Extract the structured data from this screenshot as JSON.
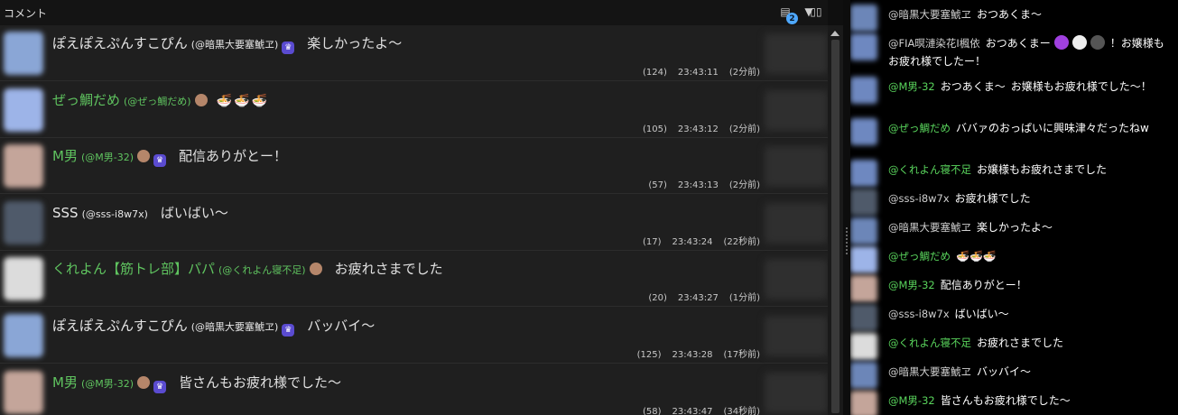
{
  "left_panel": {
    "title": "コメント",
    "header_icons": [
      {
        "name": "comment-inbox-icon",
        "glyph": "▤"
      },
      {
        "name": "filter-icon",
        "glyph": "▼"
      },
      {
        "name": "columns-icon",
        "glyph": "▯▯"
      }
    ],
    "badge_count": "2",
    "rows": [
      {
        "name": "ぽえぽえぷんすこぴん",
        "handle": "(@暗黒大要塞鯱ヱ)",
        "message": "楽しかったよ〜",
        "count": "(124)",
        "time": "23:43:11",
        "ago": "(2分前)",
        "green": false,
        "bear": false,
        "crown": true,
        "bowls": "",
        "avatar_color": "#8aa6d6"
      },
      {
        "name": "ぜっ鯛だめ",
        "handle": "(@ぜっ鯛だめ)",
        "message": "",
        "count": "(105)",
        "time": "23:43:12",
        "ago": "(2分前)",
        "green": true,
        "bear": true,
        "crown": false,
        "bowls": "🍜🍜🍜",
        "avatar_color": "#9db4e8"
      },
      {
        "name": "M男",
        "handle": "(@M男-32)",
        "message": "配信ありがとー！",
        "count": "(57)",
        "time": "23:43:13",
        "ago": "(2分前)",
        "green": true,
        "bear": true,
        "crown": true,
        "bowls": "",
        "avatar_color": "#c4a59a"
      },
      {
        "name": "SSS",
        "handle": "(@sss-i8w7x)",
        "message": "ばいばい〜",
        "count": "(17)",
        "time": "23:43:24",
        "ago": "(22秒前)",
        "green": false,
        "bear": false,
        "crown": false,
        "bowls": "",
        "avatar_color": "#4f5a6a"
      },
      {
        "name": "くれよん【筋トレ部】パパ",
        "handle": "(@くれよん寝不足)",
        "message": "お疲れさまでした",
        "count": "(20)",
        "time": "23:43:27",
        "ago": "(1分前)",
        "green": true,
        "bear": true,
        "crown": false,
        "bowls": "",
        "avatar_color": "#dcdcdc"
      },
      {
        "name": "ぽえぽえぷんすこぴん",
        "handle": "(@暗黒大要塞鯱ヱ)",
        "message": "バッバイ〜",
        "count": "(125)",
        "time": "23:43:28",
        "ago": "(17秒前)",
        "green": false,
        "bear": false,
        "crown": true,
        "bowls": "",
        "avatar_color": "#8aa6d6"
      },
      {
        "name": "M男",
        "handle": "(@M男-32)",
        "message": "皆さんもお疲れ様でした〜",
        "count": "(58)",
        "time": "23:43:47",
        "ago": "(34秒前)",
        "green": true,
        "bear": true,
        "crown": true,
        "bowls": "",
        "avatar_color": "#c4a59a"
      }
    ]
  },
  "right_panel": {
    "lines": [
      {
        "name": "@暗黒大要塞鯱ヱ",
        "text": "おつあくま〜",
        "green": false,
        "avatar_color": "#6c86b8",
        "hearts": []
      },
      {
        "name": "@FIA暝漣染花I楓依",
        "text": "おつあくまー",
        "after": "！お嬢様もお疲れ様でしたー！",
        "green": false,
        "avatar_color": "#6e88c0",
        "hearts": [
          "#a040e0",
          "#eeeeee",
          "#555555"
        ]
      },
      {
        "name": "@M男-32",
        "text": "おつあくま〜",
        "after": "お嬢様もお疲れ様でした〜！",
        "green": true,
        "avatar_color": "#6e88c0",
        "hearts": []
      },
      {
        "name": "@ぜっ鯛だめ",
        "text": "ババァのおっぱいに興味津々だったねw",
        "green": true,
        "avatar_color": "#6e88c0",
        "hearts": []
      },
      {
        "name": "@くれよん寝不足",
        "text": "お嬢様もお疲れさまでした",
        "green": true,
        "avatar_color": "#6e88c0",
        "hearts": []
      },
      {
        "name": "@sss-i8w7x",
        "text": "お疲れ様でした",
        "green": false,
        "avatar_color": "#4f5a6a",
        "hearts": []
      },
      {
        "name": "@暗黒大要塞鯱ヱ",
        "text": "楽しかったよ〜",
        "green": false,
        "avatar_color": "#6c86b8",
        "hearts": []
      },
      {
        "name": "@ぜっ鯛だめ",
        "text": "🍜🍜🍜",
        "green": true,
        "avatar_color": "#9db4e8",
        "hearts": []
      },
      {
        "name": "@M男-32",
        "text": "配信ありがとー！",
        "green": true,
        "avatar_color": "#c4a59a",
        "hearts": []
      },
      {
        "name": "@sss-i8w7x",
        "text": "ばいばい〜",
        "green": false,
        "avatar_color": "#4f5a6a",
        "hearts": []
      },
      {
        "name": "@くれよん寝不足",
        "text": "お疲れさまでした",
        "green": true,
        "avatar_color": "#dcdcdc",
        "hearts": []
      },
      {
        "name": "@暗黒大要塞鯱ヱ",
        "text": "バッバイ〜",
        "green": false,
        "avatar_color": "#6c86b8",
        "hearts": []
      },
      {
        "name": "@M男-32",
        "text": "皆さんもお疲れ様でした〜",
        "green": true,
        "avatar_color": "#c4a59a",
        "hearts": []
      }
    ]
  }
}
